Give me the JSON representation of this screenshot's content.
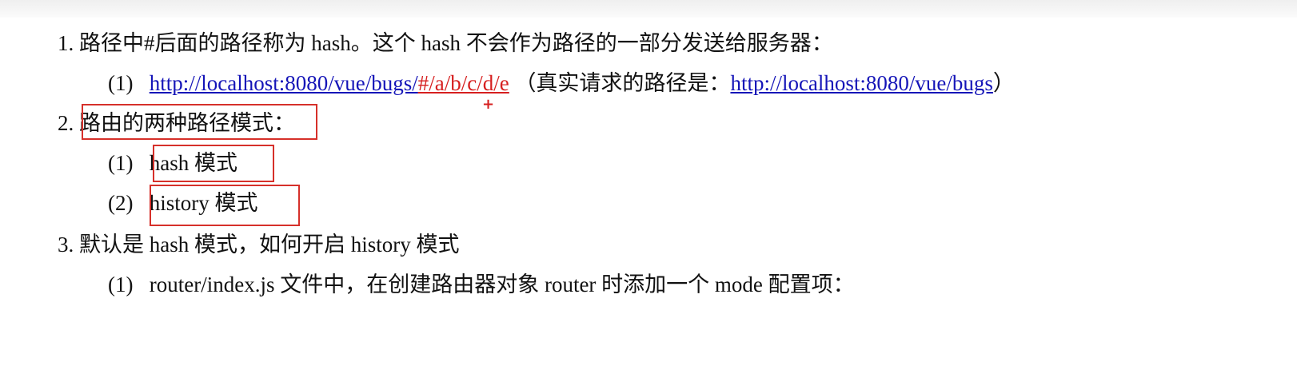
{
  "items": [
    {
      "number": "1.",
      "text": "路径中#后面的路径称为 hash。这个 hash 不会作为路径的一部分发送给服务器：",
      "sub": {
        "number": "(1)",
        "url_base": "http://localhost:8080/vue/bugs/",
        "url_hash": "#/a/b/c/d/e",
        "note_open": "（真实请求的路径是：",
        "note_url": "http://localhost:8080/vue/bugs",
        "note_close": "）"
      }
    },
    {
      "number": "2.",
      "text": "路由的两种路径模式",
      "suffix": "：",
      "subs": [
        {
          "number": "(1)",
          "text": "hash 模式"
        },
        {
          "number": "(2)",
          "text": "history 模式"
        }
      ]
    },
    {
      "number": "3.",
      "text": "默认是 hash 模式，如何开启 history 模式",
      "sub": {
        "number": "(1)",
        "text": "router/index.js 文件中，在创建路由器对象 router 时添加一个 mode 配置项："
      }
    }
  ],
  "colors": {
    "link": "#1515b8",
    "hash_highlight": "#d61f1f",
    "annotation_box": "#d6302a"
  },
  "icons": {
    "cursor": "crosshair-plus-icon"
  }
}
